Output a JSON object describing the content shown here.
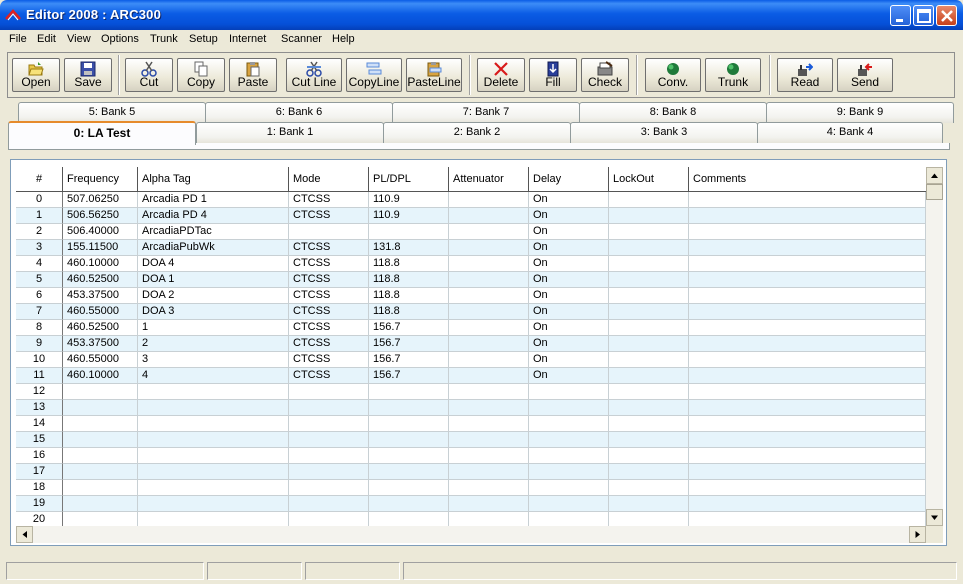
{
  "window": {
    "title": "Editor 2008 : ARC300",
    "controls": [
      "minimize-icon",
      "maximize-icon",
      "close-icon"
    ]
  },
  "menu": [
    "File",
    "Edit",
    "View",
    "Options",
    "Trunk",
    "Setup",
    "Internet",
    "Scanner",
    "Help"
  ],
  "toolbar": {
    "open": "Open",
    "save": "Save",
    "cut": "Cut",
    "copy": "Copy",
    "paste": "Paste",
    "cutline": "Cut Line",
    "copyline": "CopyLine",
    "pasteline": "PasteLine",
    "delete": "Delete",
    "fill": "Fill",
    "check": "Check",
    "conv": "Conv.",
    "trunk": "Trunk",
    "read": "Read",
    "send": "Send"
  },
  "tabs": {
    "back": [
      "5: Bank 5",
      "6: Bank 6",
      "7: Bank 7",
      "8: Bank 8",
      "9: Bank 9"
    ],
    "front": [
      "0:  LA Test",
      "1: Bank 1",
      "2: Bank 2",
      "3: Bank 3",
      "4: Bank 4"
    ],
    "active": "0:  LA Test"
  },
  "grid": {
    "columns": [
      "#",
      "Frequency",
      "Alpha Tag",
      "Mode",
      "PL/DPL",
      "Attenuator",
      "Delay",
      "LockOut",
      "Comments"
    ],
    "rows": [
      [
        "0",
        "507.06250",
        "Arcadia PD 1",
        "CTCSS",
        "110.9",
        "",
        "On",
        "",
        ""
      ],
      [
        "1",
        "506.56250",
        "Arcadia PD 4",
        "CTCSS",
        "110.9",
        "",
        "On",
        "",
        ""
      ],
      [
        "2",
        "506.40000",
        "ArcadiaPDTac",
        "",
        "",
        "",
        "On",
        "",
        ""
      ],
      [
        "3",
        "155.11500",
        "ArcadiaPubWk",
        "CTCSS",
        "131.8",
        "",
        "On",
        "",
        ""
      ],
      [
        "4",
        "460.10000",
        "DOA 4",
        "CTCSS",
        "118.8",
        "",
        "On",
        "",
        ""
      ],
      [
        "5",
        "460.52500",
        "DOA 1",
        "CTCSS",
        "118.8",
        "",
        "On",
        "",
        ""
      ],
      [
        "6",
        "453.37500",
        "DOA 2",
        "CTCSS",
        "118.8",
        "",
        "On",
        "",
        ""
      ],
      [
        "7",
        "460.55000",
        "DOA 3",
        "CTCSS",
        "118.8",
        "",
        "On",
        "",
        ""
      ],
      [
        "8",
        "460.52500",
        "1",
        "CTCSS",
        "156.7",
        "",
        "On",
        "",
        ""
      ],
      [
        "9",
        "453.37500",
        "2",
        "CTCSS",
        "156.7",
        "",
        "On",
        "",
        ""
      ],
      [
        "10",
        "460.55000",
        "3",
        "CTCSS",
        "156.7",
        "",
        "On",
        "",
        ""
      ],
      [
        "11",
        "460.10000",
        "4",
        "CTCSS",
        "156.7",
        "",
        "On",
        "",
        ""
      ],
      [
        "12",
        "",
        "",
        "",
        "",
        "",
        "",
        "",
        ""
      ],
      [
        "13",
        "",
        "",
        "",
        "",
        "",
        "",
        "",
        ""
      ],
      [
        "14",
        "",
        "",
        "",
        "",
        "",
        "",
        "",
        ""
      ],
      [
        "15",
        "",
        "",
        "",
        "",
        "",
        "",
        "",
        ""
      ],
      [
        "16",
        "",
        "",
        "",
        "",
        "",
        "",
        "",
        ""
      ],
      [
        "17",
        "",
        "",
        "",
        "",
        "",
        "",
        "",
        ""
      ],
      [
        "18",
        "",
        "",
        "",
        "",
        "",
        "",
        "",
        ""
      ],
      [
        "19",
        "",
        "",
        "",
        "",
        "",
        "",
        "",
        ""
      ],
      [
        "20",
        "",
        "",
        "",
        "",
        "",
        "",
        "",
        ""
      ]
    ]
  },
  "colors": {
    "title_bar": "#0b5ce5",
    "alt_row": "#e6f4fb",
    "active_tab_accent": "#e68b2c"
  }
}
